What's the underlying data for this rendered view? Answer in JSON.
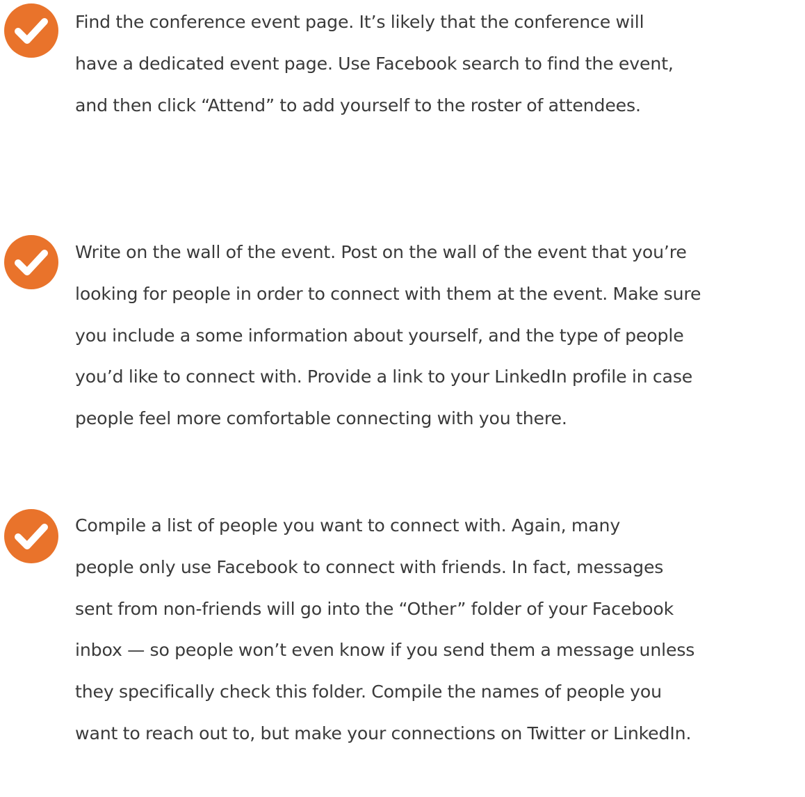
{
  "accent_color": "#e9732b",
  "check_icon": "checkmark-circle-icon",
  "items": [
    {
      "lines": [
        "Find the conference event page. It’s likely that the conference will",
        "have a dedicated event page. Use Facebook search to find the event,",
        "and then click “Attend” to add yourself to the roster of attendees."
      ]
    },
    {
      "lines": [
        "Write on the wall of the event. Post on the wall of the event that you’re",
        "looking for people in order to connect with them at the event. Make sure",
        "you include a some information about yourself, and the type of people",
        "you’d like to connect with. Provide a link to your LinkedIn profile in case",
        "people feel more comfortable connecting with you there."
      ]
    },
    {
      "lines": [
        "Compile a list of people you want to connect with. Again, many",
        "people only use Facebook to connect with friends. In fact, messages",
        "sent from non-friends will go into the “Other” folder of your Facebook",
        "inbox — so people won’t even know if you send them a message unless",
        "they specifically check this folder. Compile the names of people you",
        "want to reach out to, but make your connections on Twitter or LinkedIn."
      ]
    }
  ]
}
